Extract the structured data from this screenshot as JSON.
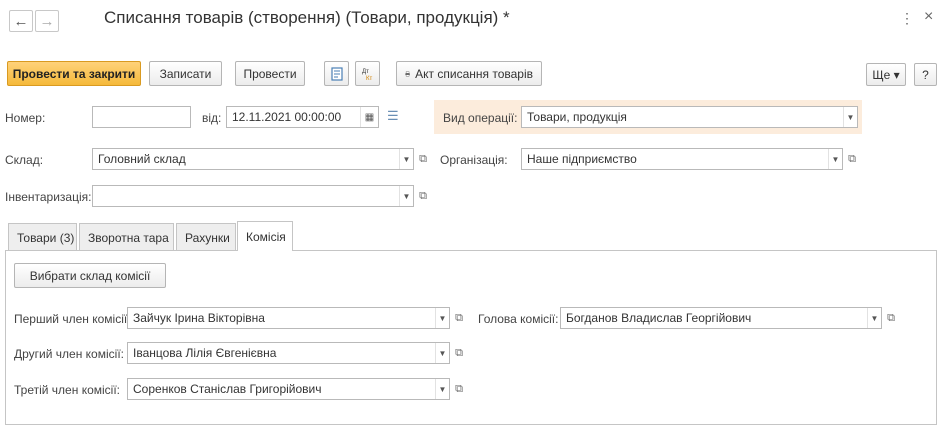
{
  "header": {
    "back_icon": "←",
    "forward_icon": "→",
    "title": "Списання товарів (створення) (Товари, продукція) *",
    "menu_icon": "⋮",
    "close_icon": "×"
  },
  "toolbar": {
    "post_close_label": "Провести та закрити",
    "save_label": "Записати",
    "post_label": "Провести",
    "act_label": "Акт списання товарів",
    "more_label": "Ще ▾",
    "help_label": "?"
  },
  "form": {
    "number_label": "Номер:",
    "number_value": "",
    "from_label": "від:",
    "date_value": "12.11.2021 00:00:00",
    "operation_label": "Вид операції:",
    "operation_value": "Товари, продукція",
    "warehouse_label": "Склад:",
    "warehouse_value": "Головний склад",
    "organization_label": "Організація:",
    "organization_value": "Наше підприємство",
    "inventory_label": "Інвентаризація:",
    "inventory_value": ""
  },
  "tabs": [
    {
      "label": "Товари (3)"
    },
    {
      "label": "Зворотна тара"
    },
    {
      "label": "Рахунки"
    },
    {
      "label": "Комісія"
    }
  ],
  "commission": {
    "choose_button": "Вибрати склад комісії",
    "first_label": "Перший член комісії:",
    "first_value": "Зайчук Ірина Вікторівна",
    "head_label": "Голова комісії:",
    "head_value": "Богданов Владислав Георгійович",
    "second_label": "Другий член комісії:",
    "second_value": "Іванцова Лілія Євгенієвна",
    "third_label": "Третій член комісії:",
    "third_value": "Соренков Станіслав Григорійович"
  }
}
